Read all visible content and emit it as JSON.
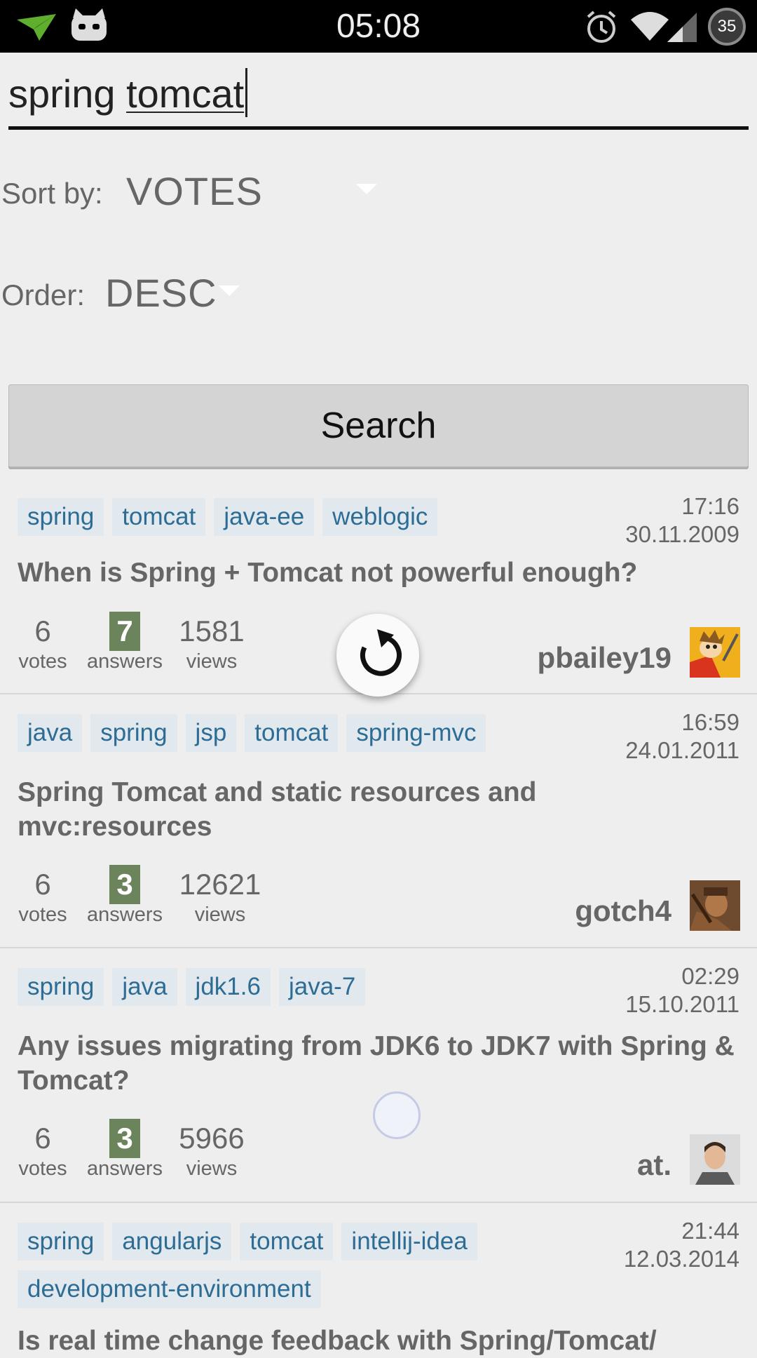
{
  "status_bar": {
    "time": "05:08",
    "battery": "35",
    "icons": [
      "airplane-app-icon",
      "cat-app-icon",
      "alarm-icon",
      "wifi-icon",
      "signal-icon",
      "battery-icon"
    ]
  },
  "search": {
    "prefix": "spring",
    "word": "tomcat",
    "button_label": "Search"
  },
  "sort": {
    "label": "Sort by:",
    "value": "VOTES"
  },
  "order": {
    "label": "Order:",
    "value": "DESC"
  },
  "colors": {
    "tag_bg": "#e1e9ee",
    "tag_text": "#2d6c94",
    "answers_badge": "#6c845c"
  },
  "results": [
    {
      "tags": [
        "spring",
        "tomcat",
        "java-ee",
        "weblogic"
      ],
      "time": "17:16",
      "date": "30.11.2009",
      "title": "When is Spring + Tomcat not powerful enough?",
      "votes": "6",
      "votes_label": "votes",
      "answers": "7",
      "answers_label": "answers",
      "views": "1581",
      "views_label": "views",
      "user": "pbailey19"
    },
    {
      "tags": [
        "java",
        "spring",
        "jsp",
        "tomcat",
        "spring-mvc"
      ],
      "time": "16:59",
      "date": "24.01.2011",
      "title_line1": "Spring Tomcat and static resources and",
      "title_line2": "mvc:resources",
      "votes": "6",
      "votes_label": "votes",
      "answers": "3",
      "answers_label": "answers",
      "views": "12621",
      "views_label": "views",
      "user": "gotch4"
    },
    {
      "tags": [
        "spring",
        "java",
        "jdk1.6",
        "java-7"
      ],
      "time": "02:29",
      "date": "15.10.2011",
      "title_line1": "Any issues migrating from JDK6 to JDK7 with Spring &",
      "title_line2": "Tomcat?",
      "votes": "6",
      "votes_label": "votes",
      "answers": "3",
      "answers_label": "answers",
      "views": "5966",
      "views_label": "views",
      "user": "at."
    },
    {
      "tags": [
        "spring",
        "angularjs",
        "tomcat",
        "intellij-idea",
        "development-environment"
      ],
      "time": "21:44",
      "date": "12.03.2014",
      "title": "Is real time change feedback with Spring/Tomcat/"
    }
  ]
}
